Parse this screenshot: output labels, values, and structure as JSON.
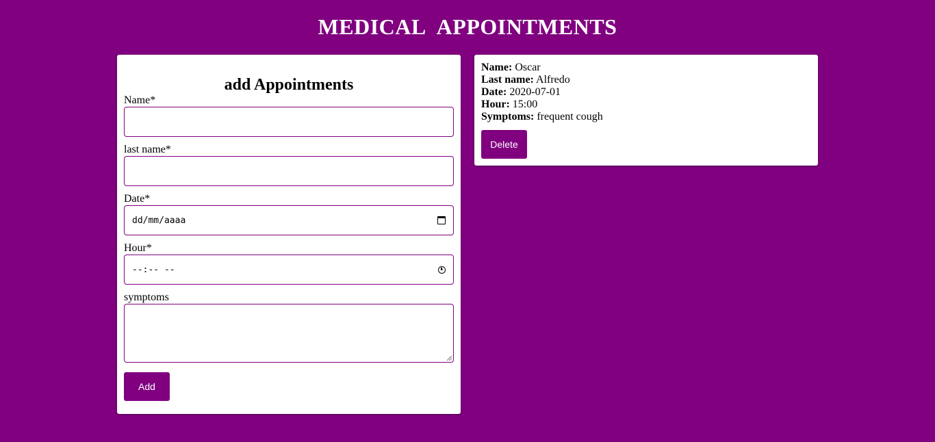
{
  "header": {
    "title": "MEDICAL   APPOINTMENTS"
  },
  "form": {
    "heading": "add Appointments",
    "fields": {
      "name": {
        "label": "Name*",
        "value": ""
      },
      "last_name": {
        "label": "last name*",
        "value": ""
      },
      "date": {
        "label": "Date*",
        "placeholder": "dd/mm/aaaa",
        "icon": "calendar-icon"
      },
      "hour": {
        "label": "Hour*",
        "placeholder": "--:-- --",
        "icon": "clock-icon"
      },
      "symptoms": {
        "label": "symptoms",
        "value": ""
      }
    },
    "submit_label": "Add"
  },
  "appointments": [
    {
      "name_label": "Name:",
      "name": "Oscar",
      "last_name_label": "Last name:",
      "last_name": "Alfredo",
      "date_label": "Date:",
      "date": "2020-07-01",
      "hour_label": "Hour:",
      "hour": "15:00",
      "symptoms_label": "Symptoms:",
      "symptoms": "frequent cough",
      "delete_label": "Delete"
    }
  ],
  "colors": {
    "background": "#800080",
    "accent": "#800080",
    "card": "#ffffff"
  }
}
